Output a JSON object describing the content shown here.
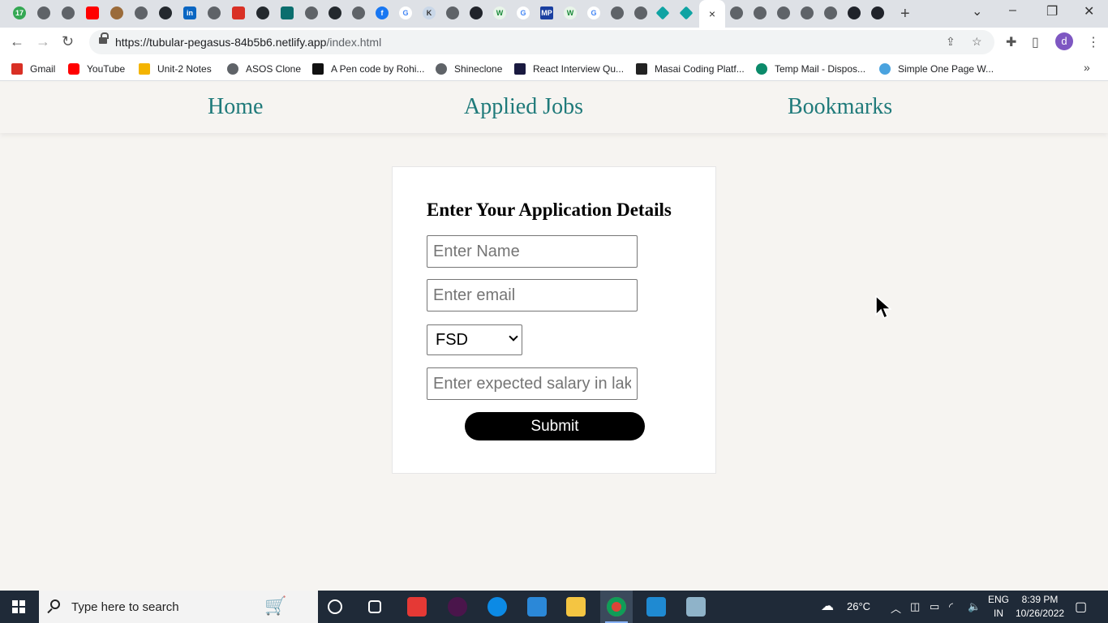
{
  "browser": {
    "url_host": "https://tubular-pegasus-84b5b6.netlify.app",
    "url_path": "/index.html",
    "profile_initial": "d",
    "active_tab_close": "×",
    "bookmarks": [
      {
        "label": "Gmail",
        "color": "#d93025"
      },
      {
        "label": "YouTube",
        "color": "#ff0000"
      },
      {
        "label": "Unit-2 Notes",
        "color": "#f4b400"
      },
      {
        "label": "ASOS Clone",
        "color": "#5f6368"
      },
      {
        "label": "A Pen code by Rohi...",
        "color": "#111111"
      },
      {
        "label": "Shineclone",
        "color": "#5f6368"
      },
      {
        "label": "React Interview Qu...",
        "color": "#1a1a40"
      },
      {
        "label": "Masai Coding Platf...",
        "color": "#222222"
      },
      {
        "label": "Temp Mail - Dispos...",
        "color": "#0b8a6a"
      },
      {
        "label": "Simple One Page W...",
        "color": "#4aa3df"
      }
    ]
  },
  "nav": {
    "home": "Home",
    "applied": "Applied Jobs",
    "bookmarks": "Bookmarks"
  },
  "form": {
    "heading": "Enter Your Application Details",
    "name_placeholder": "Enter Name",
    "email_placeholder": "Enter email",
    "role_selected": "FSD",
    "salary_placeholder": "Enter expected salary in lakhs",
    "submit_label": "Submit"
  },
  "taskbar": {
    "search_placeholder": "Type here to search",
    "temperature": "26°C",
    "lang_top": "ENG",
    "lang_bottom": "IN",
    "time": "8:39 PM",
    "date": "10/26/2022"
  },
  "colors": {
    "nav_link": "#1f7a7a",
    "page_bg": "#f6f4f1",
    "submit_bg": "#000000"
  }
}
